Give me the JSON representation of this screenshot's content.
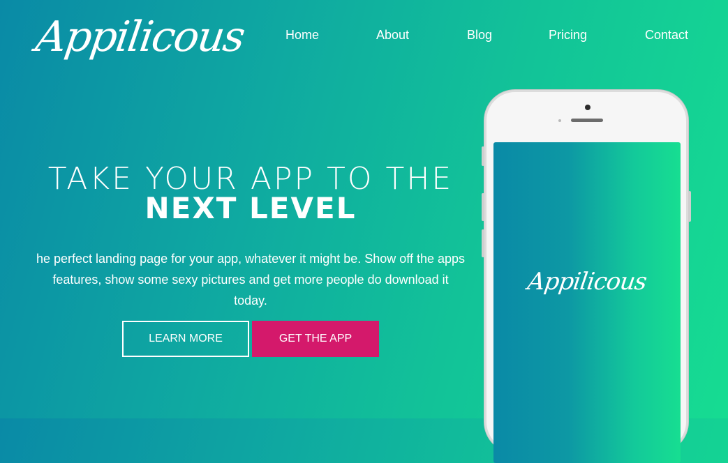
{
  "brand": {
    "logo_text": "Appilicous"
  },
  "nav": {
    "items": [
      {
        "label": "Home"
      },
      {
        "label": "About"
      },
      {
        "label": "Blog"
      },
      {
        "label": "Pricing"
      },
      {
        "label": "Contact"
      }
    ]
  },
  "hero": {
    "title_light": "TAKE YOUR APP TO THE",
    "title_bold": "NEXT LEVEL",
    "description": "he perfect landing page for your app, whatever it might be. Show off the apps features, show some sexy pictures and get more people do download it today.",
    "learn_more_label": "LEARN MORE",
    "get_app_label": "GET THE APP"
  },
  "phone": {
    "screen_logo_text": "Appilicous"
  },
  "colors": {
    "gradient_start": "#0a8aa6",
    "gradient_end": "#16dc92",
    "cta_accent": "#d4196b",
    "text": "#ffffff"
  }
}
